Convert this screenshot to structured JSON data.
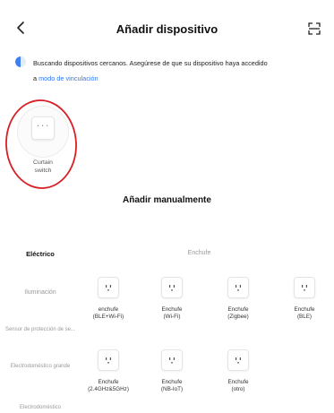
{
  "header": {
    "title": "Añadir dispositivo",
    "back_icon": "back-chevron-icon",
    "scan_icon": "scan-icon"
  },
  "notice": {
    "text": "Buscando dispositivos cercanos. Asegúrese de que su dispositivo haya accedido",
    "prefix": "a ",
    "link": "modo de vinculación"
  },
  "discovered": {
    "label_line1": "Curtain",
    "label_line2": "switch"
  },
  "manual": {
    "title": "Añadir manualmente"
  },
  "categories": [
    {
      "label": "Eléctrico",
      "active": true
    },
    {
      "label": "Iluminación",
      "active": false
    },
    {
      "label": "Sensor de protección de se...",
      "active": false
    },
    {
      "label": "Electrodoméstico grande",
      "active": false
    },
    {
      "label": "Electrodoméstico",
      "active": false
    }
  ],
  "section": {
    "title": "Enchufe"
  },
  "items": [
    {
      "line1": "enchufe",
      "line2": "(BLE+Wi-Fi)"
    },
    {
      "line1": "Enchufe",
      "line2": "(Wi-Fi)"
    },
    {
      "line1": "Enchufe",
      "line2": "(Zigbee)"
    },
    {
      "line1": "Enchufe",
      "line2": "(BLE)"
    },
    {
      "line1": "Enchufe",
      "line2": "(2.4GHz&5GHz)"
    },
    {
      "line1": "Enchufe",
      "line2": "(NB-IoT)"
    },
    {
      "line1": "Enchufe",
      "line2": "(otro)"
    }
  ],
  "colors": {
    "accent": "#2f77ee",
    "annotation_ring": "#d81f26"
  }
}
